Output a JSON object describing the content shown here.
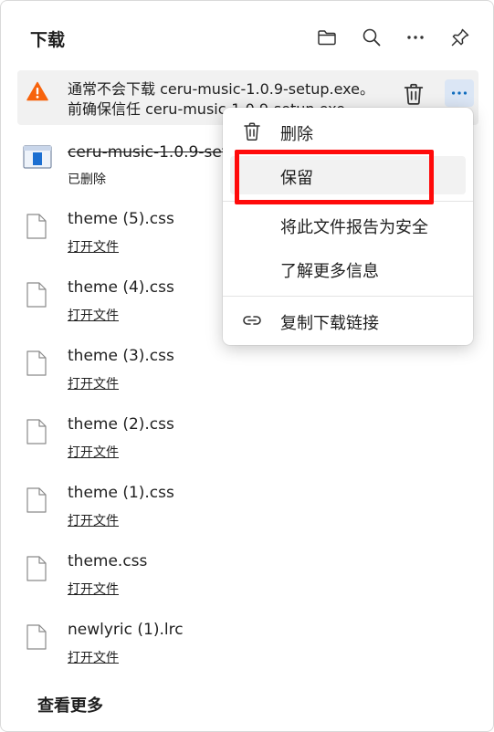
{
  "header": {
    "title": "下载"
  },
  "warning_item": {
    "line1": "通常不会下载 ceru-music-1.0.9-setup.exe。",
    "line2": "前确保信任 ceru-music-1.0.9-setup.exe"
  },
  "deleted_item": {
    "name": "ceru-music-1.0.9-setup.exe",
    "status": "已删除"
  },
  "files": [
    {
      "name": "theme (5).css",
      "action": "打开文件"
    },
    {
      "name": "theme (4).css",
      "action": "打开文件"
    },
    {
      "name": "theme (3).css",
      "action": "打开文件"
    },
    {
      "name": "theme (2).css",
      "action": "打开文件"
    },
    {
      "name": "theme (1).css",
      "action": "打开文件"
    },
    {
      "name": "theme.css",
      "action": "打开文件"
    },
    {
      "name": "newlyric (1).lrc",
      "action": "打开文件"
    }
  ],
  "see_more": "查看更多",
  "context_menu": {
    "delete": "删除",
    "keep": "保留",
    "report_safe": "将此文件报告为安全",
    "learn_more": "了解更多信息",
    "copy_link": "复制下载链接"
  },
  "colors": {
    "warning": "#f7630c",
    "accent": "#0f6cbd",
    "highlight_box": "#ff0a0a"
  }
}
